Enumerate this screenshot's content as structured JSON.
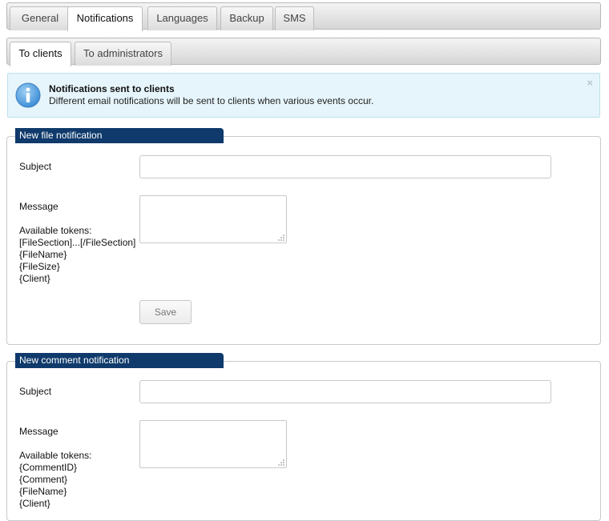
{
  "main_tabs": [
    {
      "label": "General"
    },
    {
      "label": "Notifications"
    },
    {
      "label": "Languages"
    },
    {
      "label": "Backup"
    },
    {
      "label": "SMS"
    }
  ],
  "sub_tabs": [
    {
      "label": "To clients"
    },
    {
      "label": "To administrators"
    }
  ],
  "alert": {
    "title": "Notifications sent to clients",
    "text": "Different email notifications will be sent to clients when various events occur.",
    "close": "×",
    "icon": "info-icon"
  },
  "sections": [
    {
      "legend": "New file notification",
      "subject_label": "Subject",
      "subject_value": "",
      "message_label": "Message",
      "message_value": "",
      "tokens_label": "Available tokens:",
      "tokens": [
        "[FileSection]...[/FileSection]",
        "{FileName}",
        "{FileSize}",
        "{Client}"
      ],
      "save_label": "Save"
    },
    {
      "legend": "New comment notification",
      "subject_label": "Subject",
      "subject_value": "",
      "message_label": "Message",
      "message_value": "",
      "tokens_label": "Available tokens:",
      "tokens": [
        "{CommentID}",
        "{Comment}",
        "{FileName}",
        "{Client}"
      ]
    }
  ]
}
